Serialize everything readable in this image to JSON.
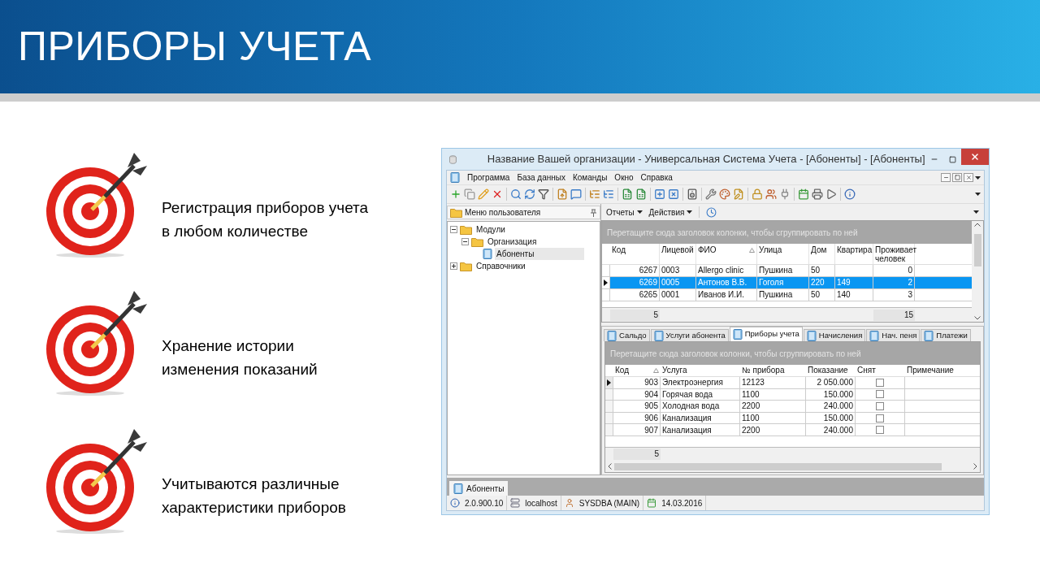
{
  "slide": {
    "title": "ПРИБОРЫ УЧЕТА",
    "features": [
      {
        "lines": [
          "Регистрация приборов учета",
          "в любом количестве"
        ]
      },
      {
        "lines": [
          "Хранение истории",
          "изменения показаний"
        ]
      },
      {
        "lines": [
          "Учитываются различные",
          "характеристики приборов"
        ]
      }
    ]
  },
  "window": {
    "title": "Название Вашей организации - Универсальная Система Учета - [Абоненты] - [Абоненты]",
    "menu": [
      {
        "label": "Программа"
      },
      {
        "label": "База данных"
      },
      {
        "label": "Команды"
      },
      {
        "label": "Окно"
      },
      {
        "label": "Справка"
      }
    ],
    "left_panel": {
      "title": "Меню пользователя",
      "tree": [
        {
          "label": "Модули",
          "expanded": true,
          "selected": false,
          "children": [
            {
              "label": "Организация",
              "expanded": true,
              "selected": false,
              "children": [
                {
                  "label": "Абоненты",
                  "selected": true
                }
              ]
            }
          ]
        },
        {
          "label": "Справочники",
          "expanded": false,
          "selected": false
        }
      ]
    },
    "toolbar2": [
      "Отчеты",
      "Действия"
    ],
    "grid": {
      "group_hint": "Перетащите сюда заголовок колонки, чтобы сгруппировать по ней",
      "columns": [
        {
          "label": "Код",
          "sorted": false
        },
        {
          "label": "Лицевой",
          "sorted": false
        },
        {
          "label": "ФИО",
          "sorted": true
        },
        {
          "label": "Улица",
          "sorted": false
        },
        {
          "label": "Дом",
          "sorted": false
        },
        {
          "label": "Квартира",
          "sorted": false
        },
        {
          "label": "Проживает человек",
          "sorted": false
        }
      ],
      "rows": [
        {
          "cells": [
            "6267",
            "0003",
            "Allergo clinic",
            "Пушкина",
            "50",
            "",
            "0"
          ],
          "selected": false
        },
        {
          "cells": [
            "6269",
            "0005",
            "Антонов В.В.",
            "Гоголя",
            "220",
            "149",
            "2"
          ],
          "selected": true
        },
        {
          "cells": [
            "6265",
            "0001",
            "Иванов И.И.",
            "Пушкина",
            "50",
            "140",
            "3"
          ],
          "selected": false
        }
      ],
      "footer": [
        "5",
        "15"
      ]
    },
    "tabs": [
      {
        "label": "Сальдо",
        "selected": false
      },
      {
        "label": "Услуги абонента",
        "selected": false
      },
      {
        "label": "Приборы учета",
        "selected": true
      },
      {
        "label": "Начисления",
        "selected": false
      },
      {
        "label": "Нач. пеня",
        "selected": false
      },
      {
        "label": "Платежи",
        "selected": false
      }
    ],
    "grid2": {
      "group_hint": "Перетащите сюда заголовок колонки, чтобы сгруппировать по ней",
      "columns": [
        {
          "label": "Код",
          "sorted": true
        },
        {
          "label": "Услуга",
          "sorted": false
        },
        {
          "label": "№ прибора",
          "sorted": false
        },
        {
          "label": "Показание",
          "sorted": false
        },
        {
          "label": "Снят",
          "sorted": false
        },
        {
          "label": "Примечание",
          "sorted": false
        }
      ],
      "rows": [
        {
          "cells": [
            "903",
            "Электроэнергия",
            "12123",
            "2 050.000",
            ""
          ],
          "checked": false,
          "selected": true
        },
        {
          "cells": [
            "904",
            "Горячая вода",
            "1100",
            "150.000",
            ""
          ],
          "checked": false,
          "selected": false
        },
        {
          "cells": [
            "905",
            "Холодная вода",
            "2200",
            "240.000",
            ""
          ],
          "checked": false,
          "selected": false
        },
        {
          "cells": [
            "906",
            "Канализация",
            "1100",
            "150.000",
            ""
          ],
          "checked": false,
          "selected": false
        },
        {
          "cells": [
            "907",
            "Канализация",
            "2200",
            "240.000",
            ""
          ],
          "checked": false,
          "selected": false
        }
      ],
      "footer": [
        "5"
      ]
    },
    "document_tabs": [
      {
        "label": "Абоненты"
      }
    ],
    "status_bar": [
      "2.0.900.10",
      "localhost",
      "SYSDBA (MAIN)",
      "14.03.2016"
    ]
  }
}
